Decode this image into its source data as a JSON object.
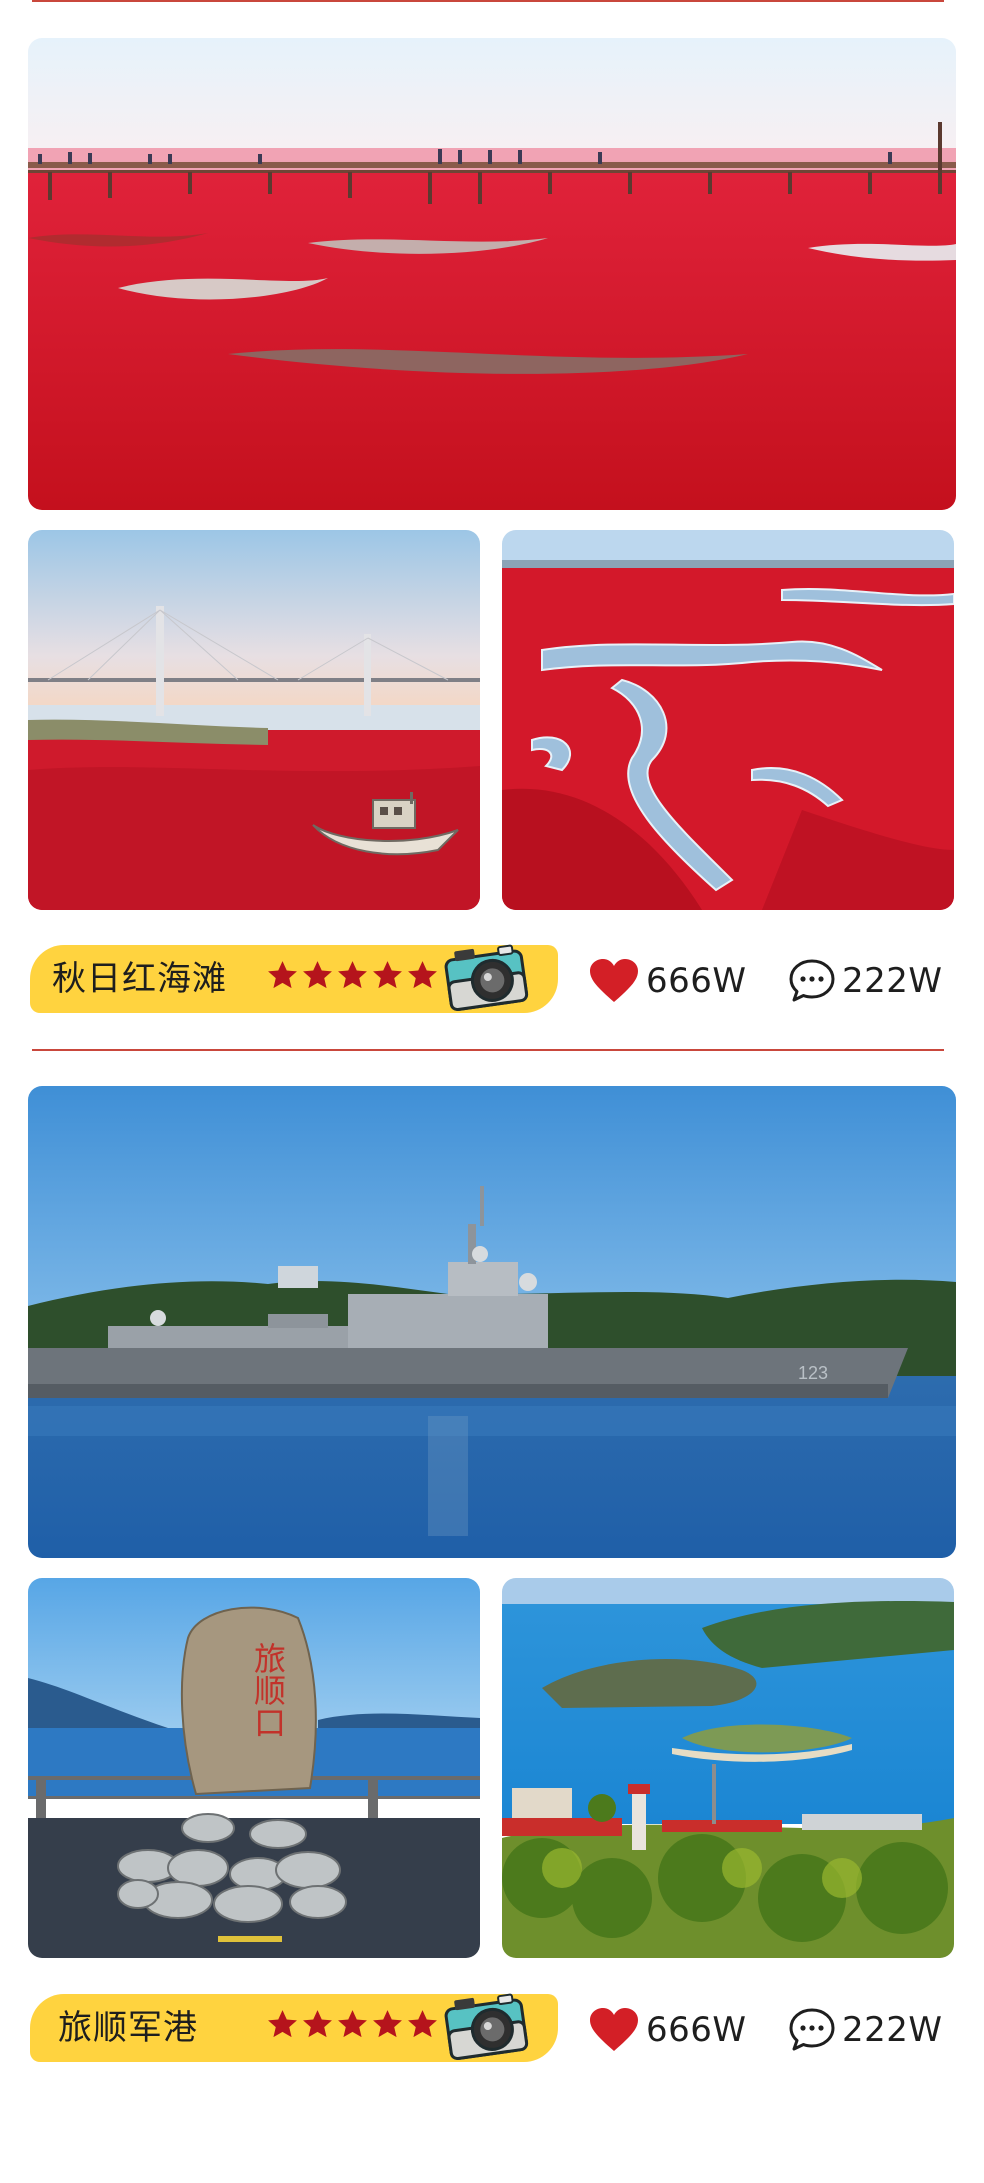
{
  "posts": [
    {
      "title": "秋日红海滩",
      "rating": 5,
      "likes": "666W",
      "comments": "222W",
      "photos": [
        "red-beach-boardwalk",
        "red-beach-bridge-boat",
        "red-beach-river"
      ]
    },
    {
      "title": "旅顺军港",
      "rating": 5,
      "likes": "666W",
      "comments": "222W",
      "photos": [
        "navy-warship",
        "lushunkou-stone",
        "coastal-island-view"
      ],
      "stone_text": "旅顺口",
      "ship_number": "123"
    }
  ],
  "icons": {
    "like": "heart-icon",
    "comment": "comment-bubble-icon",
    "star": "star-icon",
    "camera": "camera-icon"
  },
  "colors": {
    "caption_bg": "#ffd33f",
    "star": "#b5141c",
    "heart": "#d31f26",
    "divider": "#c9473c"
  }
}
